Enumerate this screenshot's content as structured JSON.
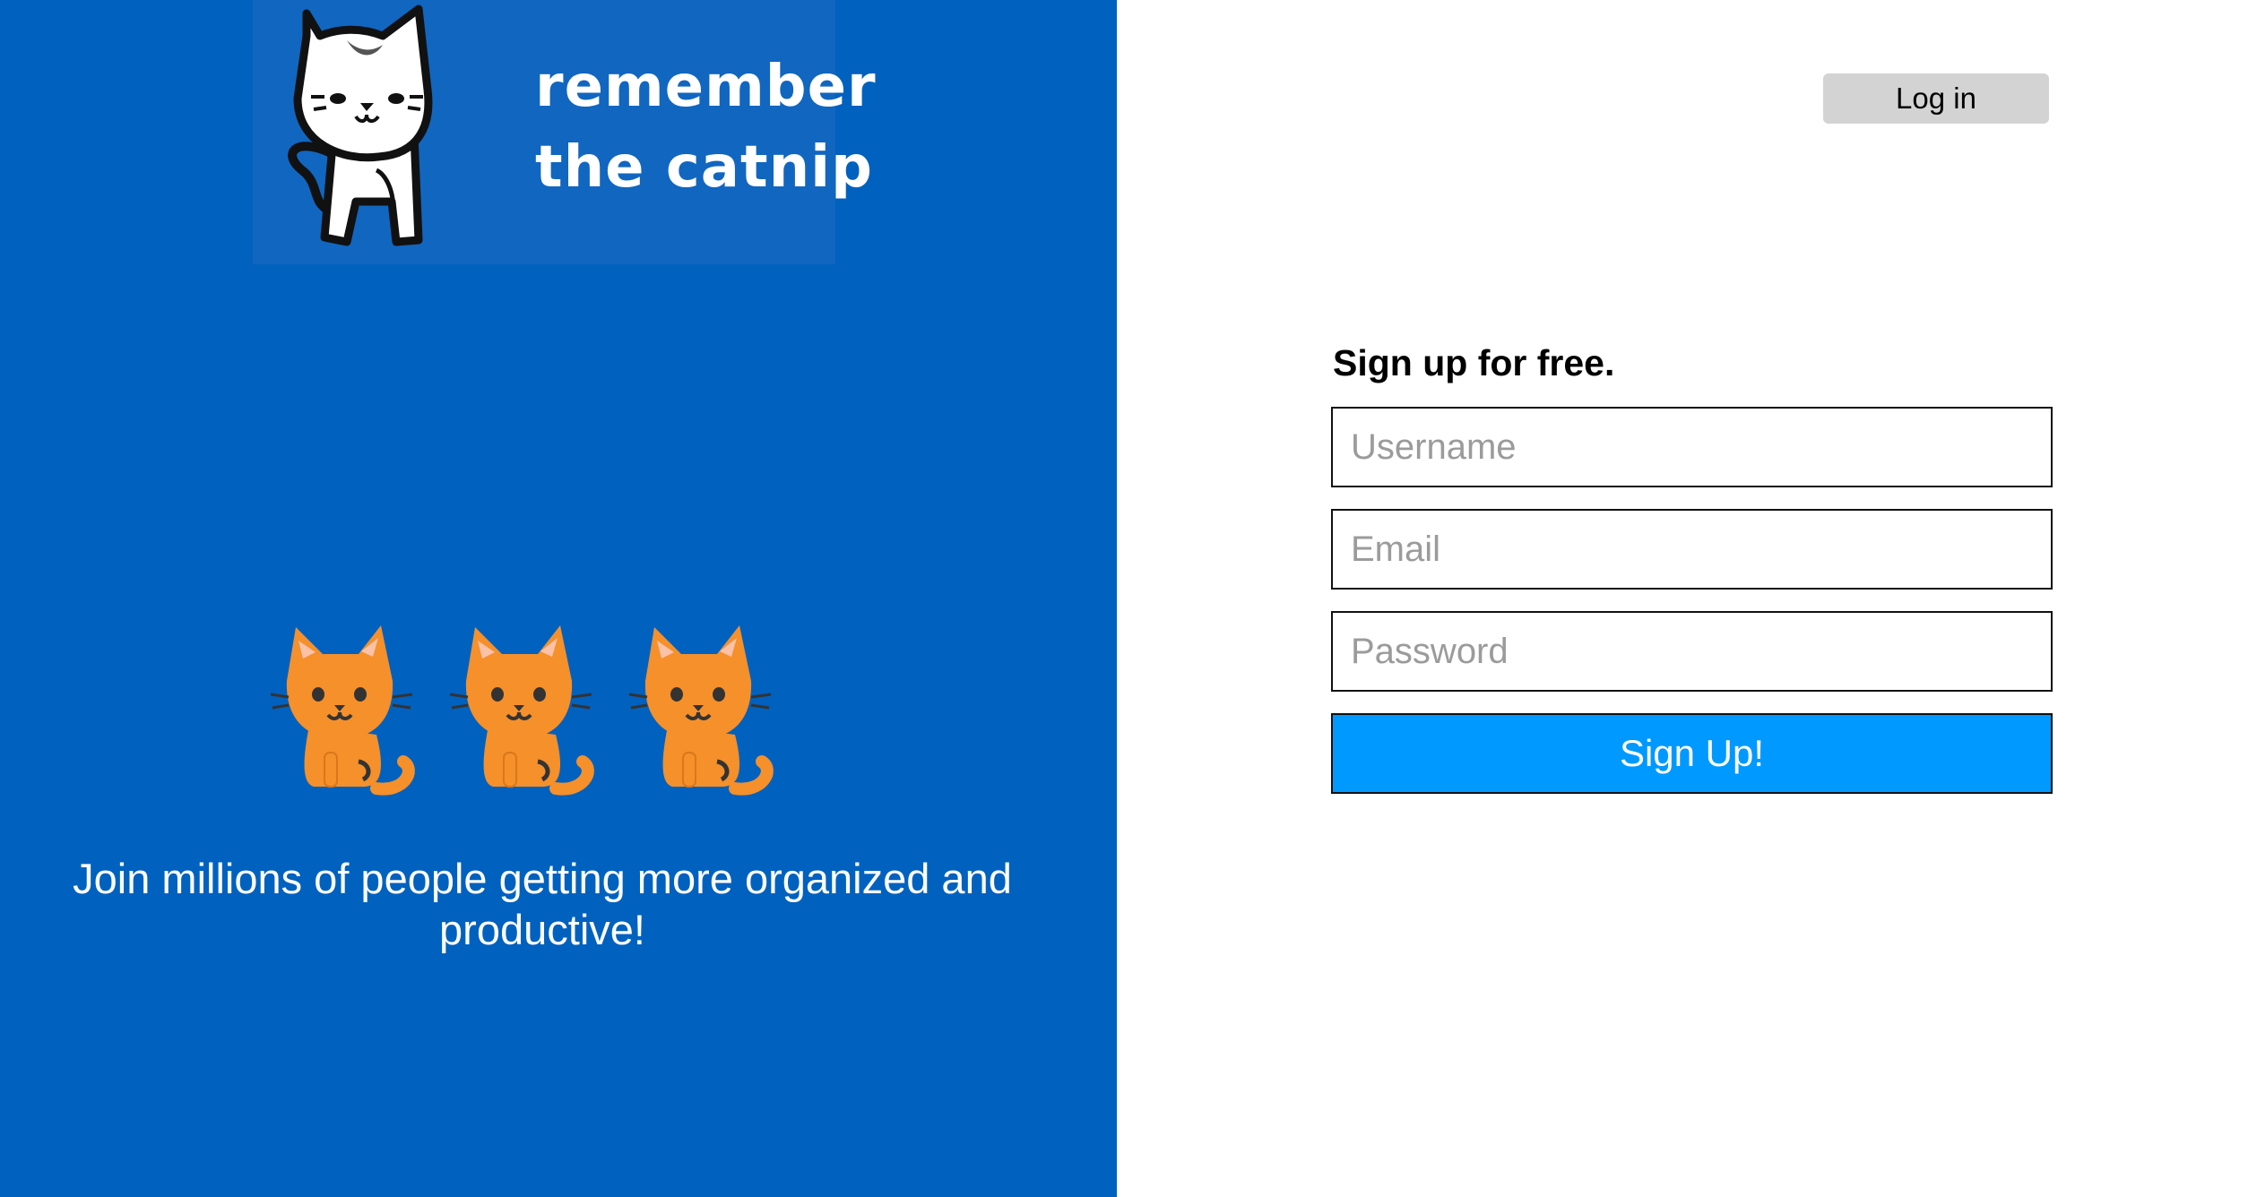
{
  "brand": {
    "logo_line1": "remember",
    "logo_line2": "the catnip",
    "logo_icon": "white-cat-logo-icon",
    "panel_color": "#0161bf",
    "logo_bg_color": "#1166c0"
  },
  "hero": {
    "cat_icons": [
      "cat-emoji-icon",
      "cat-emoji-icon",
      "cat-emoji-icon"
    ],
    "tagline": "Join millions of people getting more organized and productive!"
  },
  "header": {
    "login_label": "Log in"
  },
  "signup": {
    "heading": "Sign up for free.",
    "username_placeholder": "Username",
    "email_placeholder": "Email",
    "password_placeholder": "Password",
    "submit_label": "Sign Up!",
    "submit_color": "#0099ff"
  }
}
